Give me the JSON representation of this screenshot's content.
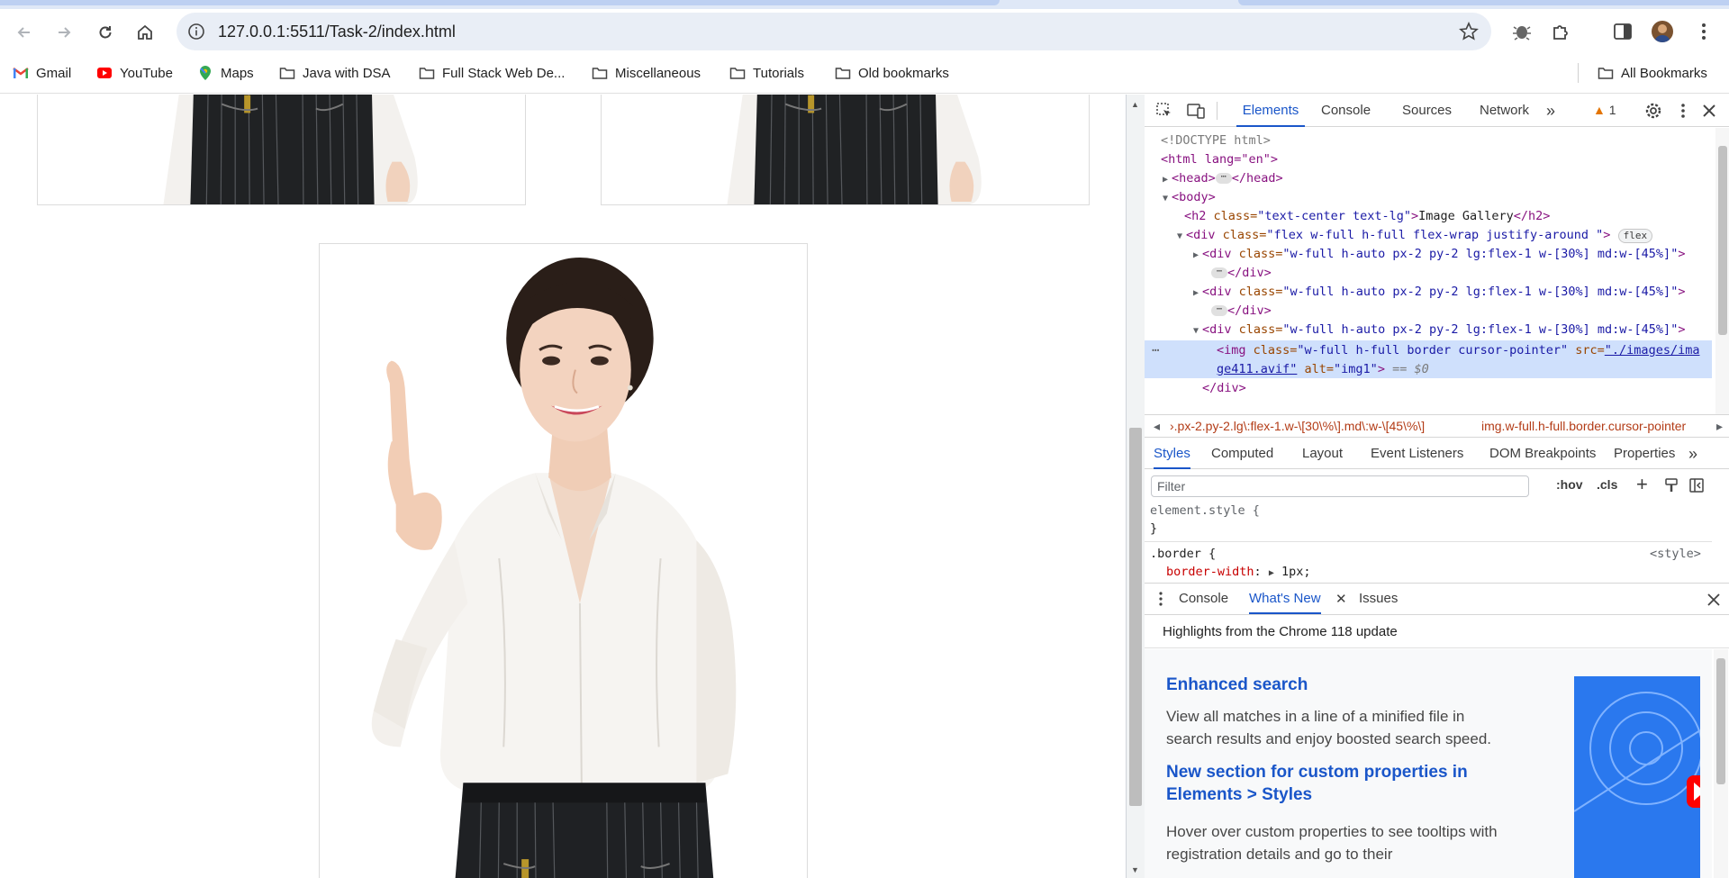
{
  "browser": {
    "url": "127.0.0.1:5511/Task-2/index.html",
    "bookmarks": [
      "Gmail",
      "YouTube",
      "Maps",
      "Java with DSA",
      "Full Stack Web De...",
      "Miscellaneous",
      "Tutorials",
      "Old bookmarks"
    ],
    "all_bookmarks": "All Bookmarks"
  },
  "devtools": {
    "tabs": [
      "Elements",
      "Console",
      "Sources",
      "Network"
    ],
    "warning_count": "1",
    "dom": {
      "doctype": "<!DOCTYPE html>",
      "html_open": "<html lang=\"en\">",
      "head_open": "<head>",
      "head_close": "</head>",
      "body_open": "<body>",
      "h2_tag_open": "<h2 ",
      "h2_attr": "class=",
      "h2_val": "\"text-center text-lg\"",
      "h2_text": "Image Gallery",
      "h2_close": "</h2>",
      "div_open": "<div ",
      "div_attr": "class=",
      "div_val": "\"flex w-full h-full flex-wrap justify-around \"",
      "div_close_bracket": ">",
      "flex_badge": "flex",
      "child_val": "\"w-full h-auto px-2 py-2 lg:flex-1 w-[30%] md:w-[45%]\"",
      "child_close": "</div>",
      "img_open": "<img ",
      "img_class_val": "\"w-full h-full border cursor-pointer\"",
      "img_src_attr": " src=",
      "img_src_1": "\"./images/ima",
      "img_src_2": "ge411.avif\"",
      "img_alt_attr": " alt=",
      "img_alt_val": "\"img1\"",
      "img_end": ">",
      "dollar0": " == $0"
    },
    "crumbs": {
      "left": "›.px-2.py-2.lg\\:flex-1.w-\\[30\\%\\].md\\:w-\\[45\\%\\]",
      "right": "img.w-full.h-full.border.cursor-pointer"
    },
    "style_tabs": [
      "Styles",
      "Computed",
      "Layout",
      "Event Listeners",
      "DOM Breakpoints",
      "Properties"
    ],
    "filter_placeholder": "Filter",
    "hov": ":hov",
    "cls": ".cls",
    "rules": {
      "element_style": "element.style {",
      "close": "}",
      "border_selector": ".border {",
      "border_source": "<style>",
      "border_prop": "border-width",
      "border_val": "1px;"
    },
    "drawer_tabs": [
      "Console",
      "What's New",
      "Issues"
    ],
    "whats_new": {
      "heading": "Highlights from the Chrome 118 update",
      "f1_title": "Enhanced search",
      "f1_desc": "View all matches in a line of a minified file in search results and enjoy boosted search speed.",
      "f2_title": "New section for custom properties in Elements > Styles",
      "f2_desc": "Hover over custom properties to see tooltips with registration details and go to their"
    }
  },
  "colors": {
    "accent": "#1a56c9",
    "selected_row": "#cfe0fc"
  }
}
